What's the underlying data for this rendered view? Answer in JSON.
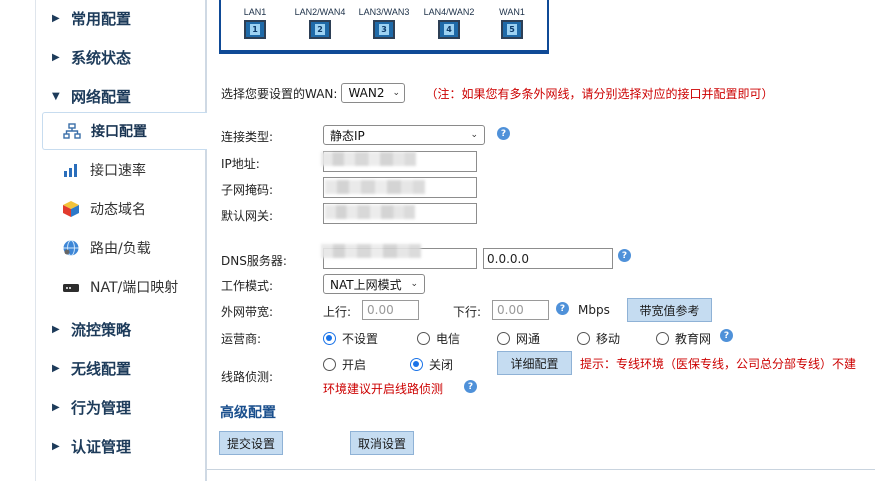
{
  "sidebar": {
    "items": [
      {
        "label": "常用配置"
      },
      {
        "label": "系统状态"
      },
      {
        "label": "网络配置"
      },
      {
        "label": "接口配置"
      },
      {
        "label": "接口速率"
      },
      {
        "label": "动态域名"
      },
      {
        "label": "路由/负载"
      },
      {
        "label": "NAT/端口映射"
      },
      {
        "label": "流控策略"
      },
      {
        "label": "无线配置"
      },
      {
        "label": "行为管理"
      },
      {
        "label": "认证管理"
      }
    ]
  },
  "ports": [
    {
      "name": "LAN1",
      "num": "1"
    },
    {
      "name": "LAN2/WAN4",
      "num": "2"
    },
    {
      "name": "LAN3/WAN3",
      "num": "3"
    },
    {
      "name": "LAN4/WAN2",
      "num": "4"
    },
    {
      "name": "WAN1",
      "num": "5"
    }
  ],
  "wan_select": {
    "label": "选择您要设置的WAN:",
    "value": "WAN2",
    "note": "（注：如果您有多条外网线，请分别选择对应的接口并配置即可）"
  },
  "conn_type": {
    "label": "连接类型:",
    "value": "静态IP"
  },
  "ip": {
    "label": "IP地址:"
  },
  "mask": {
    "label": "子网掩码:"
  },
  "gateway": {
    "label": "默认网关:"
  },
  "dns": {
    "label": "DNS服务器:",
    "secondary": "0.0.0.0"
  },
  "mode": {
    "label": "工作模式:",
    "value": "NAT上网模式"
  },
  "bandwidth": {
    "label": "外网带宽:",
    "up_label": "上行:",
    "up_placeholder": "0.00",
    "down_label": "下行:",
    "down_placeholder": "0.00",
    "unit": "Mbps",
    "ref_button": "带宽值参考"
  },
  "isp": {
    "label": "运营商:",
    "options": [
      "不设置",
      "电信",
      "网通",
      "移动",
      "教育网"
    ],
    "selected": "不设置"
  },
  "line_detect": {
    "label": "线路侦测:",
    "on_label": "开启",
    "off_label": "关闭",
    "selected": "关闭",
    "detail_button": "详细配置",
    "tip": "提示：专线环境（医保专线，公司总分部专线）不建",
    "tip2": "环境建议开启线路侦测"
  },
  "advanced": {
    "title": "高级配置"
  },
  "actions": {
    "submit": "提交设置",
    "cancel": "取消设置"
  },
  "colors": {
    "accent": "#0f4a96",
    "note": "#cc0000",
    "button": "#c5dcf1",
    "help": "#4f91d9"
  }
}
